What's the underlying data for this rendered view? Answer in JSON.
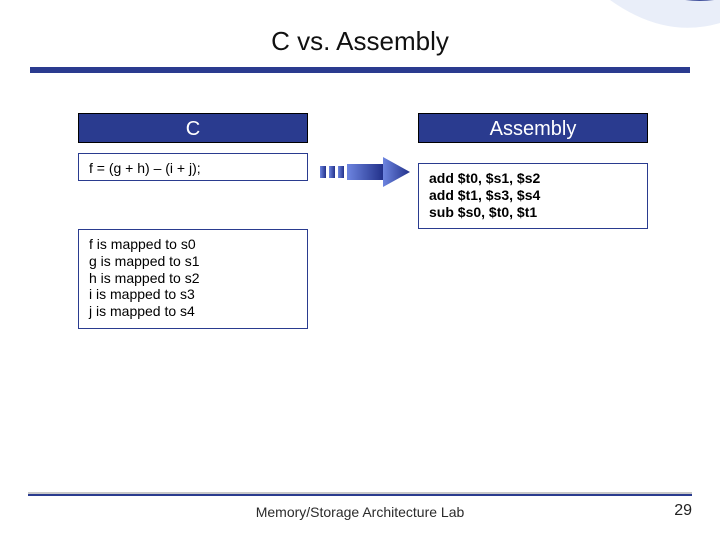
{
  "slide": {
    "title": "C vs. Assembly",
    "columns": {
      "left_header": "C",
      "right_header": "Assembly"
    },
    "c_code": "f = (g + h) – (i + j);",
    "mapping_lines": [
      "f  is mapped to s0",
      "g is mapped to s1",
      "h is mapped to s2",
      "i  is mapped to s3",
      "j  is mapped to s4"
    ],
    "asm_lines": [
      "add $t0, $s1, $s2",
      "add $t1, $s3, $s4",
      "sub $s0, $t0, $t1"
    ],
    "footer_label": "Memory/Storage Architecture Lab",
    "page_number": "29"
  },
  "colors": {
    "brand_blue": "#2a3b8f",
    "arrow_blue": "#3a57c4"
  }
}
